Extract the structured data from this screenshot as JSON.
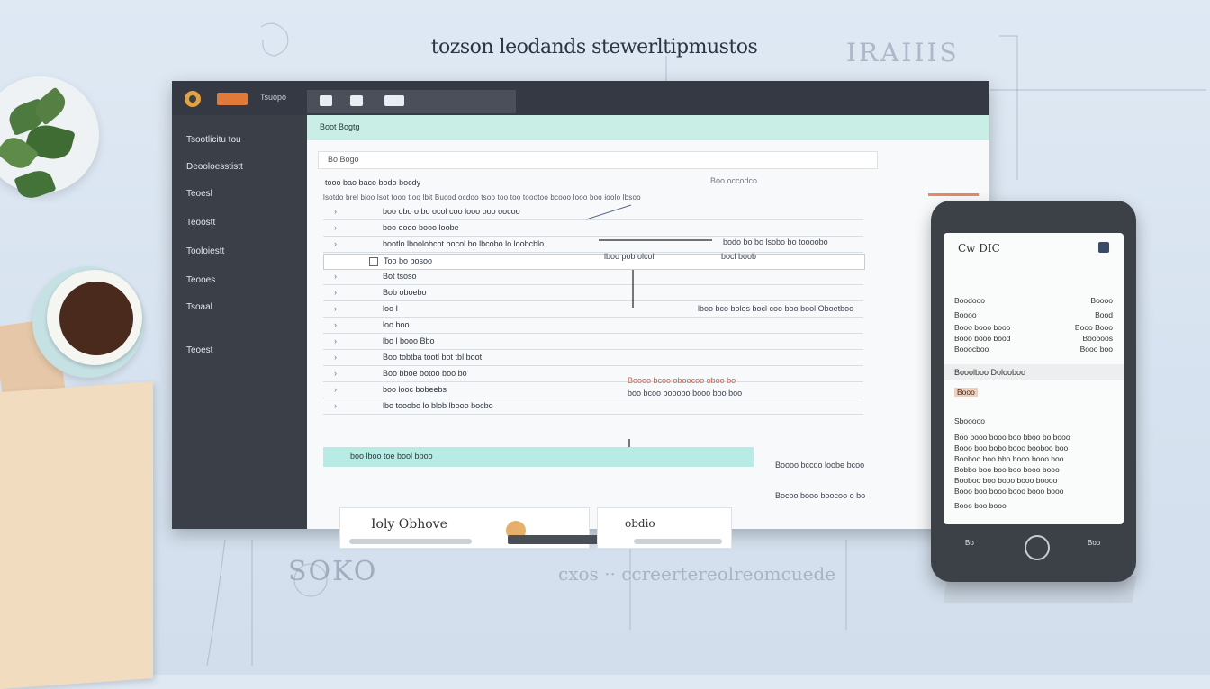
{
  "headline": "tozson leodands stewerltipmustos",
  "scrawls": {
    "top_right": "IRAIIIS",
    "footer_left": "SOKO",
    "footer_right": "cxos ·· ccreertereolreomcuede"
  },
  "monitor": {
    "top_label": "Tsuopo",
    "tabs": [
      "",
      "",
      ""
    ],
    "sidebar": {
      "items": [
        "Tsootlicitu tou",
        "Deooloesstistt",
        "Teoesl",
        "Teoostt",
        "Tooloiestt",
        "Teooes",
        "Tsoaal",
        "Teoest"
      ]
    },
    "banner_label": "Boot Bogtg",
    "search": {
      "value": "Bo Bogo"
    },
    "toolbar": "tooo  bao  baco bodo bocdy",
    "toolbar_right": "Boo occodco",
    "column_header": "lsotdo brel bioo lsot tooo tloo lbit Bucod ocdoo  tsoo too too toootoo bcooo looo boo ioolo lbsoo",
    "rows": [
      {
        "num": "",
        "text": "boo obo o bo ocol coo looo  ooo oocoo"
      },
      {
        "num": "",
        "text": "boo oooo  booo  loobe"
      },
      {
        "num": "",
        "text": "bootlo lboolobcot bocol bo lbcobo lo loobcblo"
      },
      {
        "num": "",
        "text": "Too bo bosoo"
      },
      {
        "num": "",
        "text": "Bot tsoso"
      },
      {
        "num": "",
        "text": "Bob oboebo"
      },
      {
        "num": "",
        "text": "loo I"
      },
      {
        "num": "",
        "text": "loo boo"
      },
      {
        "num": "",
        "text": "lbo l booo Bbo"
      },
      {
        "num": "",
        "text": "Boo tobtba tootl bot tbl boot"
      },
      {
        "num": "",
        "text": "Boo bboe botoo boo bo"
      },
      {
        "num": "",
        "text": "boo looc bobeebs"
      },
      {
        "num": "",
        "text": "lbo tooobo lo blob lbooo bocbo"
      }
    ],
    "highlight_row": "boo lboo toe bool bboo",
    "annotations": {
      "middle": "lboo pob olcol",
      "middle_right": "bocl boob",
      "right_1": "bodo bo bo lsobo bo toooobo",
      "right_2": "lboo bco bolos bocl coo boo bool Oboetboo",
      "red": "Boooo bcoo oboocoo oboo bo",
      "red_sub": "boo bcoo booobo booo boo boo",
      "right_3": "Boooo bccdo loobe bcoo",
      "right_4": "Bocoo booo boocoo o bo"
    },
    "bottom_cards": [
      {
        "label": "Ioly Obhove"
      },
      {
        "label": "obdio"
      }
    ]
  },
  "phone": {
    "title": "Cw  DIC",
    "lines": [
      {
        "left": "Boodooo",
        "right": "Boooo"
      },
      {
        "left": "Boooo",
        "right": "Bood"
      },
      {
        "left": "Booo booo booo",
        "right": "Booo Booo"
      },
      {
        "left": "Booo booo bood",
        "right": "Booboos"
      },
      {
        "left": "Booocboo",
        "right": "Booo boo"
      }
    ],
    "section_label": "Booolboo  Dolooboo",
    "orange_tag": "Booo",
    "subhead": "Sbooooo",
    "paragraph": [
      "Boo booo booo boo bboo bo booo",
      "Booo boo bobo booo booboo boo",
      "Booboo boo bbo booo booo boo",
      "Bobbo boo boo boo booo booo",
      "Booboo boo booo booo boooo",
      "Booo boo booo booo booo booo",
      "Booo boo booo"
    ],
    "nav": {
      "left": "Bo",
      "right": "Boo"
    }
  },
  "colors": {
    "accent_teal": "#b8ebe4",
    "banner_green": "#c9eee6",
    "sidebar": "#3b3f48",
    "orange": "#e07a3a",
    "warn_red": "#d45c44"
  }
}
